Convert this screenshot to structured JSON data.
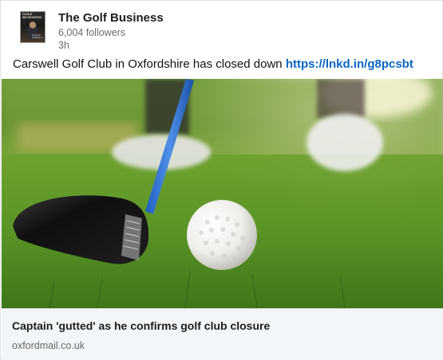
{
  "author": {
    "name": "The Golf Business",
    "followers": "6,004 followers",
    "time": "3h",
    "avatar": {
      "masthead": "GOLF BUSINESS",
      "cover_text": "Stephen Malkinson"
    }
  },
  "post": {
    "text": "Carswell Golf Club in Oxfordshire has closed down ",
    "link": "https://lnkd.in/g8pcsbt"
  },
  "image": {
    "subject": "golf club driver addressing a golf ball on grass"
  },
  "preview": {
    "title": "Captain 'gutted' as he confirms golf club closure",
    "domain": "oxfordmail.co.uk"
  },
  "colors": {
    "link": "#0a66c2",
    "muted": "#6b6b6b",
    "preview_bg": "#f3f6f8"
  }
}
